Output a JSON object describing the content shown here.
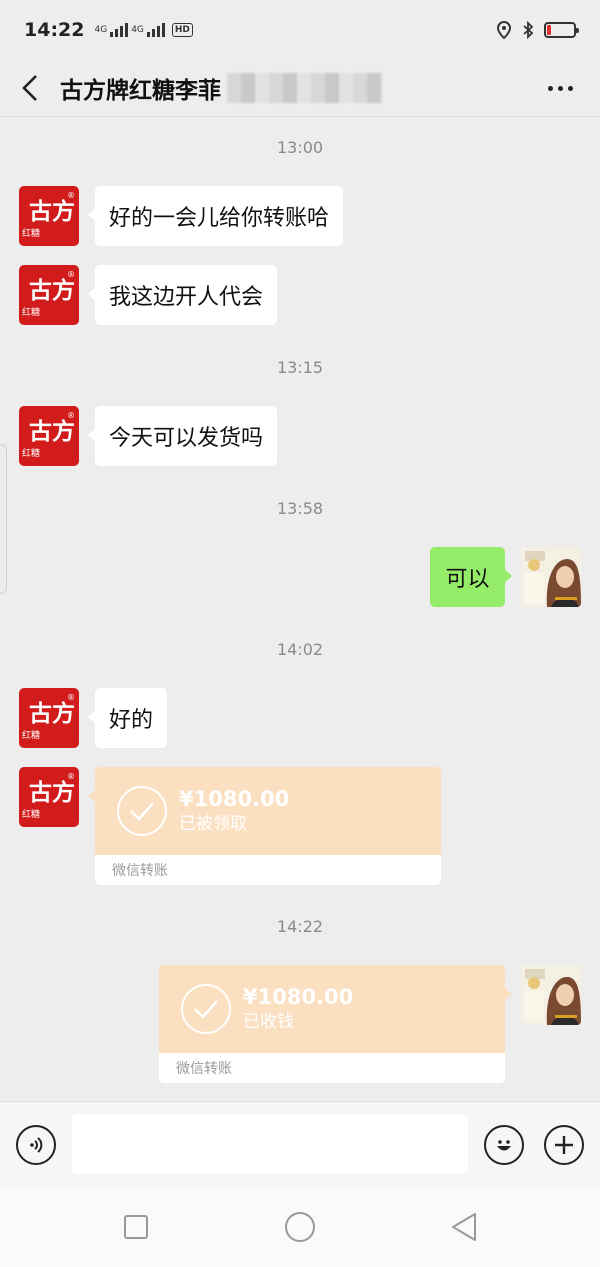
{
  "status_bar": {
    "time": "14:22",
    "network1": "4G",
    "network2": "4G",
    "hd": "HD",
    "battery_level": 0.15
  },
  "header": {
    "title": "古方牌红糖李菲"
  },
  "messages": {
    "ts1": "13:00",
    "m1": "好的一会儿给你转账哈",
    "m2": "我这边开人代会",
    "ts2": "13:15",
    "m3": "今天可以发货吗",
    "ts3": "13:58",
    "m4": "可以",
    "ts4": "14:02",
    "m5": "好的",
    "transfer1": {
      "amount": "¥1080.00",
      "status": "已被领取",
      "footer": "微信转账"
    },
    "ts5": "14:22",
    "transfer2": {
      "amount": "¥1080.00",
      "status": "已收钱",
      "footer": "微信转账"
    }
  },
  "avatar_logo": {
    "main": "古方",
    "sub": "红糖",
    "mark": "®"
  },
  "colors": {
    "brand_red": "#d21b1b",
    "sent_bubble": "#95ec69",
    "transfer_bg": "#fbdfc1"
  },
  "icons": {
    "back": "chevron-left-icon",
    "more": "more-dots-icon",
    "voice": "voice-icon",
    "emoji": "emoji-icon",
    "add": "plus-icon",
    "recent": "square-icon",
    "home": "circle-icon",
    "back_nav": "triangle-back-icon"
  }
}
